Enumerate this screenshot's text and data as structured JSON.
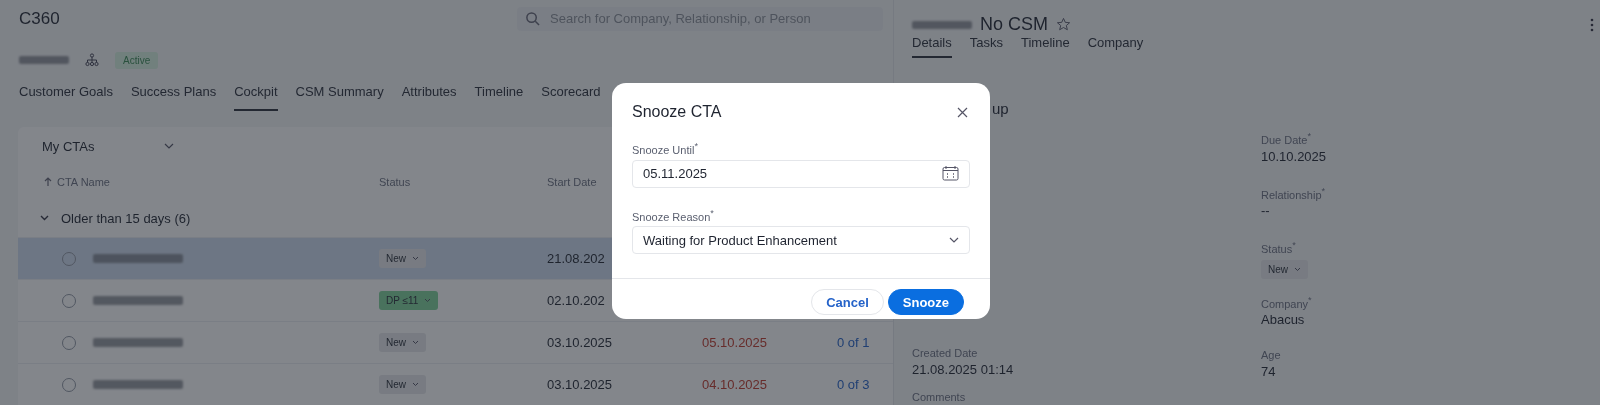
{
  "app": {
    "title": "C360",
    "search": {
      "placeholder": "Search for Company, Relationship, or Person"
    }
  },
  "account": {
    "badge": "Active"
  },
  "tabs": [
    {
      "label": "Customer Goals",
      "selected": false
    },
    {
      "label": "Success Plans",
      "selected": false
    },
    {
      "label": "Cockpit",
      "selected": true
    },
    {
      "label": "CSM Summary",
      "selected": false
    },
    {
      "label": "Attributes",
      "selected": false
    },
    {
      "label": "Timeline",
      "selected": false
    },
    {
      "label": "Scorecard",
      "selected": false
    }
  ],
  "cockpit": {
    "view": "My CTAs",
    "columns": [
      "CTA Name",
      "Status",
      "Start Date"
    ],
    "group": {
      "label": "Older than 15 days (6)",
      "expanded": true
    },
    "rows": [
      {
        "selected": true,
        "checked": false,
        "status": "New",
        "kind": "new",
        "start_date": "21.08.202"
      },
      {
        "selected": false,
        "checked": false,
        "status": "DP ≤11",
        "kind": "green",
        "start_date": "02.10.202"
      },
      {
        "selected": false,
        "checked": false,
        "status": "New",
        "kind": "new",
        "start_date": "03.10.2025",
        "due_date": "05.10.2025",
        "tasks": "0 of 1"
      },
      {
        "selected": false,
        "checked": false,
        "status": "New",
        "kind": "new",
        "start_date": "03.10.2025",
        "due_date": "04.10.2025",
        "tasks": "0 of 3"
      }
    ]
  },
  "detail": {
    "title": "No CSM",
    "starred": false,
    "tabs": [
      {
        "label": "Details",
        "selected": true
      },
      {
        "label": "Tasks",
        "selected": false
      },
      {
        "label": "Timeline",
        "selected": false
      },
      {
        "label": "Company",
        "selected": false
      }
    ],
    "heading": "up",
    "left_fields": [
      {
        "label": "Created Date",
        "value": "21.08.2025 01:14",
        "kind": "text"
      },
      {
        "label": "Comments",
        "kind": "text"
      }
    ],
    "right_fields": [
      {
        "label": "Due Date$^{*}$",
        "value": "10.10.2025",
        "kind": "text"
      },
      {
        "label": "Relationship$^{*}$",
        "value": "--",
        "kind": "text"
      },
      {
        "label": "Status$^{*}$",
        "value": "New",
        "kind": "chip"
      },
      {
        "label": "Company$^{*}$",
        "value": "Abacus",
        "kind": "text"
      },
      {
        "label": "Age",
        "value": "74",
        "kind": "text"
      }
    ]
  },
  "modal": {
    "title": "Snooze CTA",
    "until": {
      "label": "Snooze Until$^{*}$",
      "value": "05.11.2025"
    },
    "reason": {
      "label": "Snooze Reason$^{*}$",
      "value": "Waiting for Product Enhancement"
    },
    "buttons": [
      {
        "label": "Cancel",
        "kind": "secondary"
      },
      {
        "label": "Snooze",
        "kind": "primary"
      }
    ]
  }
}
